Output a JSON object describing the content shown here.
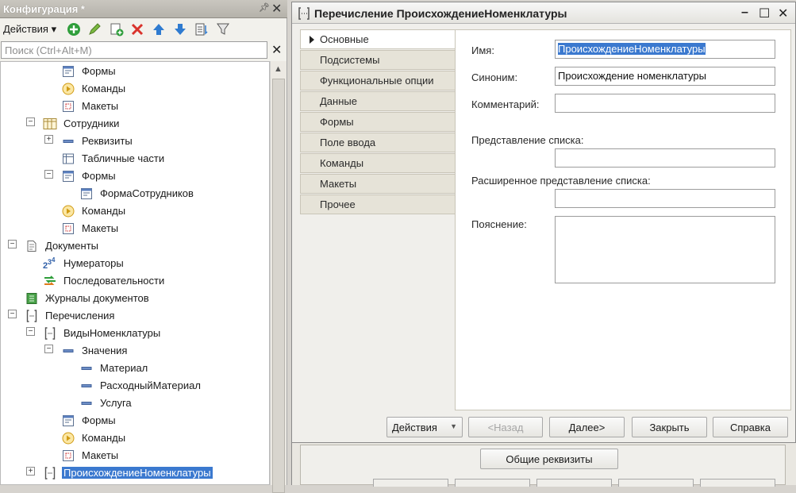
{
  "config_panel": {
    "title": "Конфигурация *",
    "pin_icon": "pin-icon",
    "actions_label": "Действия",
    "search_placeholder": "Поиск (Ctrl+Alt+M)",
    "tree": [
      {
        "label": "Формы",
        "icon": "form-icon"
      },
      {
        "label": "Команды",
        "icon": "command-icon"
      },
      {
        "label": "Макеты",
        "icon": "template-icon"
      },
      {
        "label": "Сотрудники",
        "icon": "catalog-icon"
      },
      {
        "label": "Реквизиты",
        "icon": "attribute-icon"
      },
      {
        "label": "Табличные части",
        "icon": "tabular-section-icon"
      },
      {
        "label": "Формы",
        "icon": "form-icon"
      },
      {
        "label": "ФормаСотрудников",
        "icon": "form-icon"
      },
      {
        "label": "Команды",
        "icon": "command-icon"
      },
      {
        "label": "Макеты",
        "icon": "template-icon"
      },
      {
        "label": "Документы",
        "icon": "document-icon"
      },
      {
        "label": "Нумераторы",
        "icon": "numerator-icon"
      },
      {
        "label": "Последовательности",
        "icon": "sequence-icon"
      },
      {
        "label": "Журналы документов",
        "icon": "journal-icon"
      },
      {
        "label": "Перечисления",
        "icon": "enum-icon"
      },
      {
        "label": "ВидыНоменклатуры",
        "icon": "enum-icon"
      },
      {
        "label": "Значения",
        "icon": "attribute-icon"
      },
      {
        "label": "Материал",
        "icon": "attribute-icon"
      },
      {
        "label": "РасходныйМатериал",
        "icon": "attribute-icon"
      },
      {
        "label": "Услуга",
        "icon": "attribute-icon"
      },
      {
        "label": "Формы",
        "icon": "form-icon"
      },
      {
        "label": "Команды",
        "icon": "command-icon"
      },
      {
        "label": "Макеты",
        "icon": "template-icon"
      },
      {
        "label": "ПроисхождениеНоменклатуры",
        "icon": "enum-icon",
        "selected": true
      }
    ]
  },
  "edit_window": {
    "title": "Перечисление ПроисхождениеНоменклатуры",
    "tabs": [
      {
        "label": "Основные",
        "active": true
      },
      {
        "label": "Подсистемы"
      },
      {
        "label": "Функциональные опции"
      },
      {
        "label": "Данные"
      },
      {
        "label": "Формы"
      },
      {
        "label": "Поле ввода"
      },
      {
        "label": "Команды"
      },
      {
        "label": "Макеты"
      },
      {
        "label": "Прочее"
      }
    ],
    "fields": {
      "name_label": "Имя:",
      "name_value": "ПроисхождениеНоменклатуры",
      "synonym_label": "Синоним:",
      "synonym_value": "Происхождение номенклатуры",
      "comment_label": "Комментарий:",
      "comment_value": "",
      "list_presentation_label": "Представление списка:",
      "list_presentation_value": "",
      "extended_list_presentation_label": "Расширенное представление списка:",
      "extended_list_presentation_value": "",
      "explanation_label": "Пояснение:",
      "explanation_value": ""
    },
    "buttons": {
      "actions": "Действия",
      "back": "<Назад",
      "next": "Далее>",
      "close": "Закрыть",
      "help": "Справка"
    }
  },
  "background": {
    "general_props_button": "Общие реквизиты"
  },
  "colors": {
    "selection": "#3b79cf",
    "add_icon": "#2f9e3b",
    "delete_icon": "#d9322b",
    "move_icon": "#2f7bd0"
  }
}
